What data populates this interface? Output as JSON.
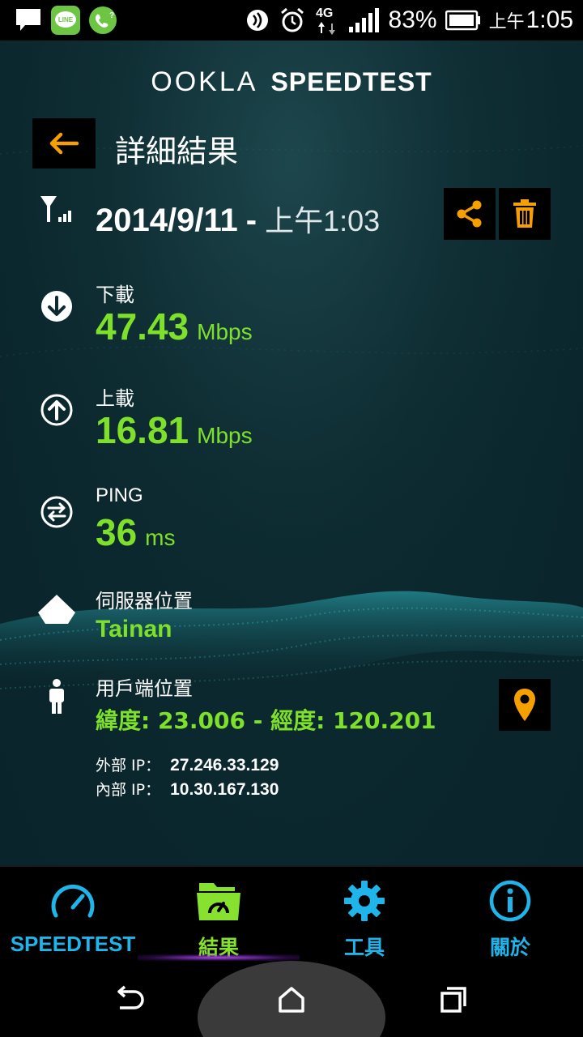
{
  "status_bar": {
    "battery_percent": "83%",
    "time_prefix": "上午",
    "time": "1:05",
    "network": "4G"
  },
  "header": {
    "logo_primary": "OOKLA",
    "logo_secondary": "SPEEDTEST",
    "page_title": "詳細結果"
  },
  "result": {
    "date": "2014/9/11",
    "separator": "-",
    "time": "上午1:03",
    "download": {
      "label": "下載",
      "value": "47.43",
      "unit": "Mbps"
    },
    "upload": {
      "label": "上載",
      "value": "16.81",
      "unit": "Mbps"
    },
    "ping": {
      "label": "PING",
      "value": "36",
      "unit": "ms"
    },
    "server": {
      "label": "伺服器位置",
      "value": "Tainan"
    },
    "client": {
      "label": "用戶端位置",
      "value": "緯度: 23.006 - 經度: 120.201"
    },
    "external_ip": {
      "label": "外部 IP：",
      "value": "27.246.33.129"
    },
    "internal_ip": {
      "label": "內部 IP：",
      "value": "10.30.167.130"
    }
  },
  "bottom_nav": {
    "items": [
      {
        "label": "SPEEDTEST",
        "color": "#1fb4ea"
      },
      {
        "label": "結果",
        "color": "#86e22e",
        "active": true
      },
      {
        "label": "工具",
        "color": "#1fb4ea"
      },
      {
        "label": "關於",
        "color": "#1fb4ea"
      }
    ]
  },
  "colors": {
    "accent_orange": "#f5a000",
    "value_green": "#7ee02a",
    "nav_blue": "#1fb4ea",
    "background": "#0c2a30"
  }
}
